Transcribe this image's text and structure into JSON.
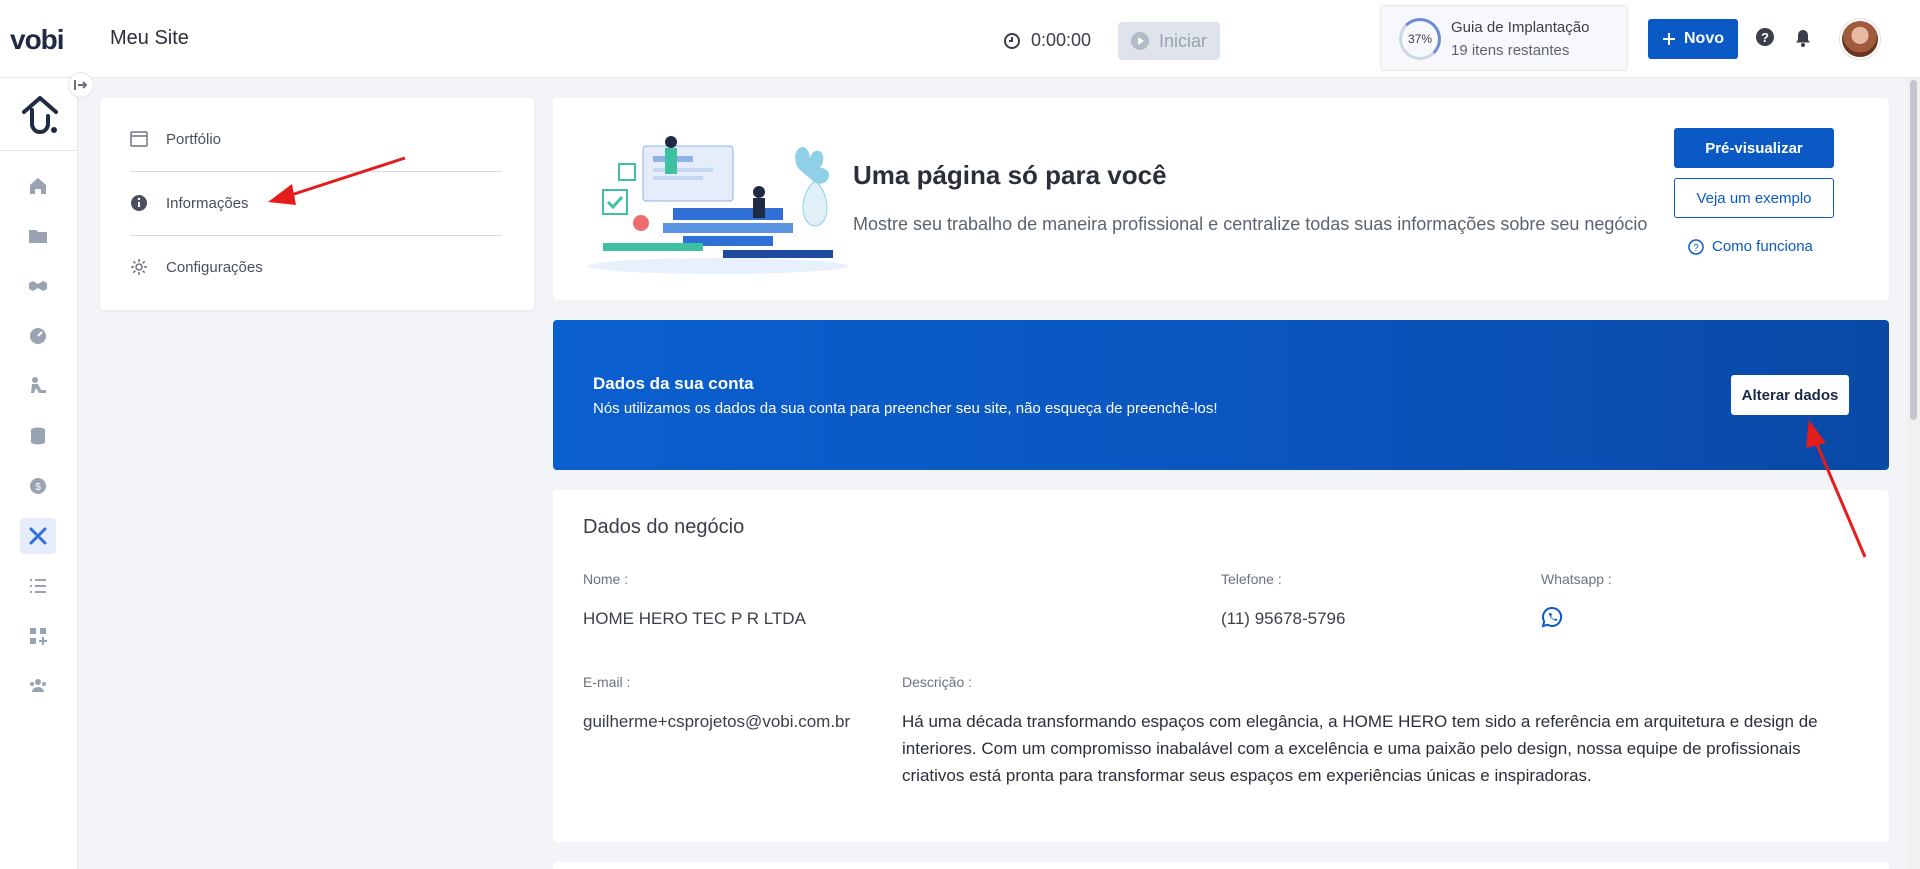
{
  "app": {
    "logo": "vobi",
    "page_title": "Meu Site"
  },
  "timer": {
    "value": "0:00:00",
    "start_label": "Iniciar"
  },
  "guide": {
    "percent": "37%",
    "progress": 0.37,
    "title": "Guia de Implantação",
    "subtitle": "19 itens restantes"
  },
  "header": {
    "new_label": "Novo",
    "help": "?"
  },
  "side_menu": {
    "items": [
      {
        "label": "Portfólio",
        "icon": "browser-window-icon"
      },
      {
        "label": "Informações",
        "icon": "info-circle-icon"
      },
      {
        "label": "Configurações",
        "icon": "gear-icon"
      }
    ]
  },
  "hero": {
    "title": "Uma página só para você",
    "description": "Mostre seu trabalho de maneira profissional e centralize todas suas informações sobre seu negócio",
    "preview_label": "Pré-visualizar",
    "example_label": "Veja um exemplo",
    "how_label": "Como funciona"
  },
  "account_banner": {
    "title": "Dados da sua conta",
    "description": "Nós utilizamos os dados da sua conta para preencher seu site, não esqueça de preenchê-los!",
    "button_label": "Alterar dados"
  },
  "business": {
    "title": "Dados do negócio",
    "name_label": "Nome :",
    "name_value": "HOME HERO TEC P R LTDA",
    "phone_label": "Telefone :",
    "phone_value": "(11) 95678-5796",
    "whatsapp_label": "Whatsapp :",
    "email_label": "E-mail :",
    "email_value": "guilherme+csprojetos@vobi.com.br",
    "description_label": "Descrição :",
    "description_value": "Há uma década transformando espaços com elegância, a HOME HERO tem sido a referência em arquitetura e design de interiores. Com um compromisso inabalável com a excelência e uma paixão pelo design, nossa equipe de profissionais criativos está pronta para transformar seus espaços em experiências únicas e inspiradoras."
  },
  "colors": {
    "primary": "#0a59c5",
    "banner": "#0a56c0",
    "annotation": "#e51c1c"
  }
}
